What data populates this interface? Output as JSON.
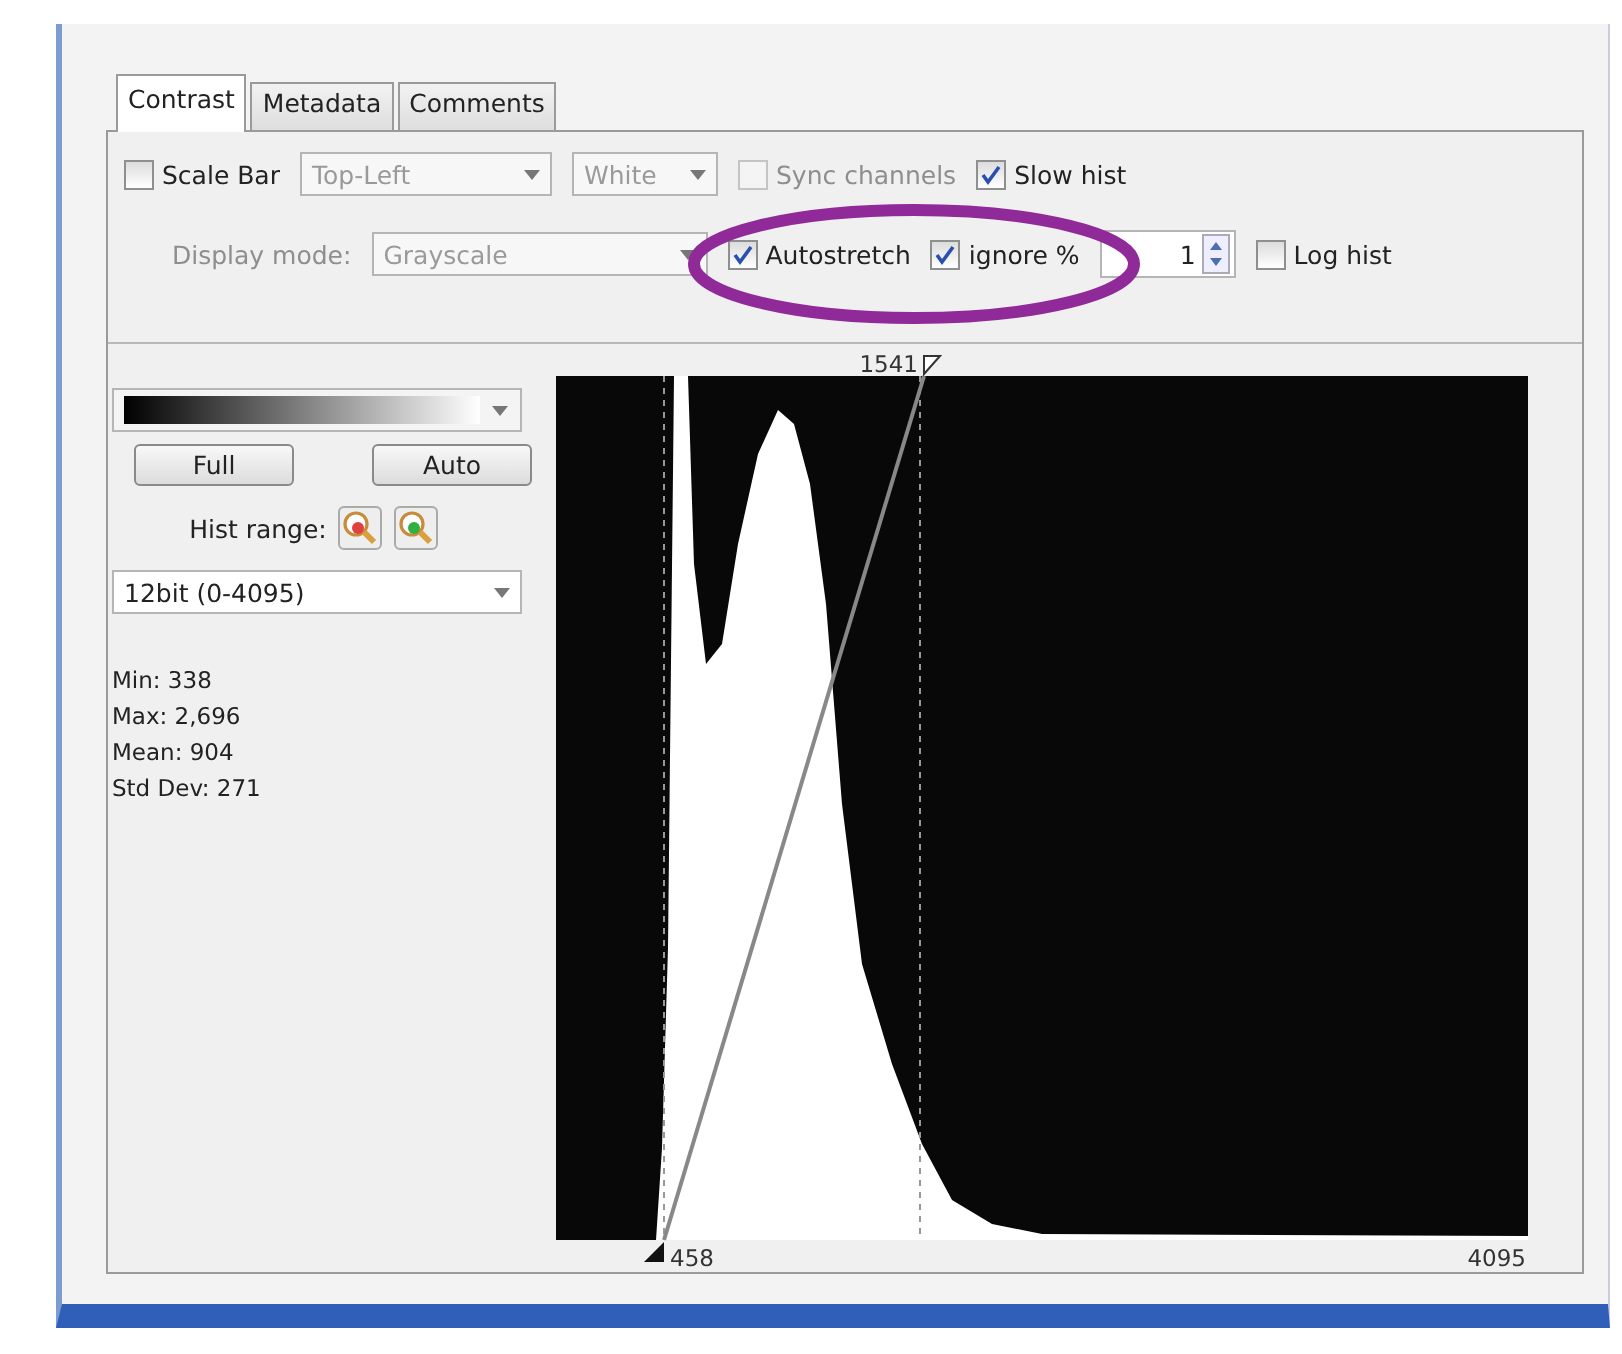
{
  "tabs": [
    {
      "label": "Contrast",
      "selected": true
    },
    {
      "label": "Metadata",
      "selected": false
    },
    {
      "label": "Comments",
      "selected": false
    }
  ],
  "toolbar": {
    "row_1": [
      {
        "kind": "checkbox",
        "label": "Scale Bar",
        "checked": false,
        "disabled": false
      },
      {
        "kind": "combo",
        "value": "Top-Left",
        "disabled": true
      },
      {
        "kind": "combo",
        "value": "White",
        "disabled": true
      },
      {
        "kind": "checkbox",
        "label": "Sync channels",
        "checked": false,
        "disabled": true
      },
      {
        "kind": "checkbox",
        "label": "Slow hist",
        "checked": true,
        "disabled": false
      }
    ],
    "row_2": [
      {
        "kind": "label",
        "text": "Display mode:",
        "disabled": true
      },
      {
        "kind": "combo",
        "value": "Grayscale",
        "disabled": true
      },
      {
        "kind": "checkbox",
        "label": "Autostretch",
        "checked": true,
        "disabled": false
      },
      {
        "kind": "checkbox",
        "label": "ignore %",
        "checked": true,
        "disabled": false
      },
      {
        "kind": "spinner",
        "value": "1"
      },
      {
        "kind": "checkbox",
        "label": "Log hist",
        "checked": false,
        "disabled": false
      }
    ]
  },
  "left_panel": {
    "buttons": [
      "Full",
      "Auto"
    ],
    "hist_range_label": "Hist range:",
    "bit_depth": "12bit (0-4095)",
    "stats": [
      "Min: 338",
      "Max: 2,696",
      "Mean: 904",
      "Std Dev: 271"
    ]
  },
  "histogram": {
    "max_label": "1541",
    "min_label": "458",
    "range_end": "4095"
  },
  "annotation": {
    "kind": "ellipse"
  }
}
